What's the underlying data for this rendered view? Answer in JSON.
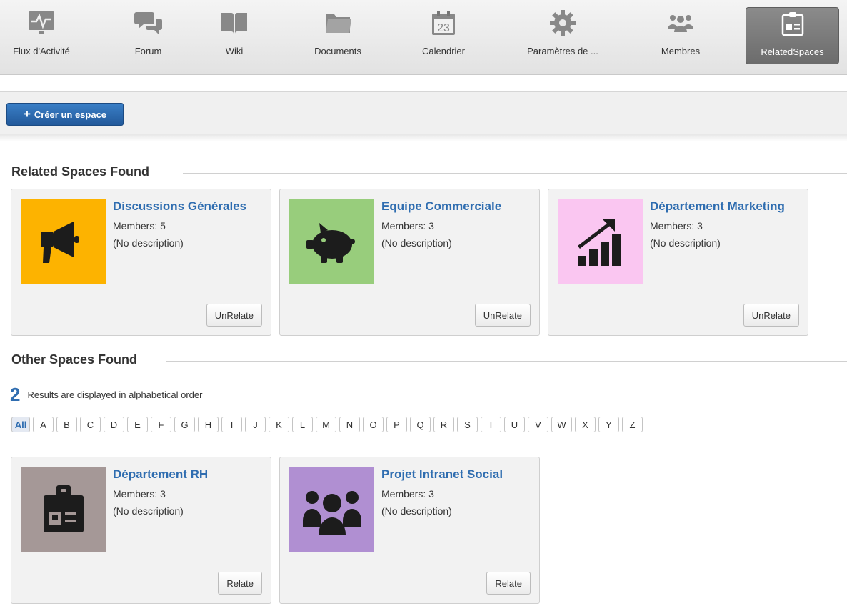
{
  "nav": {
    "items": [
      {
        "label": "Flux d'Activité",
        "icon": "activity-stream-icon"
      },
      {
        "label": "Forum",
        "icon": "forum-icon"
      },
      {
        "label": "Wiki",
        "icon": "wiki-icon"
      },
      {
        "label": "Documents",
        "icon": "documents-icon"
      },
      {
        "label": "Calendrier",
        "icon": "calendar-icon",
        "day": "23"
      },
      {
        "label": "Paramètres de ...",
        "icon": "settings-icon"
      },
      {
        "label": "Membres",
        "icon": "members-icon"
      },
      {
        "label": "RelatedSpaces",
        "icon": "related-spaces-icon",
        "active": true
      }
    ]
  },
  "toolbar": {
    "create_plus": "+",
    "create_label": "Créer un espace"
  },
  "related": {
    "title": "Related Spaces Found",
    "spaces": [
      {
        "name": "Discussions Générales",
        "members": "Members: 5",
        "description": "(No description)",
        "action": "UnRelate",
        "color": "#fdb300",
        "icon": "megaphone-icon"
      },
      {
        "name": "Equipe Commerciale",
        "members": "Members: 3",
        "description": "(No description)",
        "action": "UnRelate",
        "color": "#98cd7c",
        "icon": "piggy-bank-icon"
      },
      {
        "name": "Département Marketing",
        "members": "Members: 3",
        "description": "(No description)",
        "action": "UnRelate",
        "color": "#fac6f1",
        "icon": "growth-chart-icon"
      }
    ]
  },
  "other": {
    "title": "Other Spaces Found",
    "count": "2",
    "results_text": "Results are displayed in alphabetical order",
    "letters": [
      "All",
      "A",
      "B",
      "C",
      "D",
      "E",
      "F",
      "G",
      "H",
      "I",
      "J",
      "K",
      "L",
      "M",
      "N",
      "O",
      "P",
      "Q",
      "R",
      "S",
      "T",
      "U",
      "V",
      "W",
      "X",
      "Y",
      "Z"
    ],
    "active_letter": "All",
    "spaces": [
      {
        "name": "Département RH",
        "members": "Members: 3",
        "description": "(No description)",
        "action": "Relate",
        "color": "#a59897",
        "icon": "id-badge-icon"
      },
      {
        "name": "Projet Intranet Social",
        "members": "Members: 3",
        "description": "(No description)",
        "action": "Relate",
        "color": "#b08fd2",
        "icon": "group-icon"
      }
    ]
  }
}
